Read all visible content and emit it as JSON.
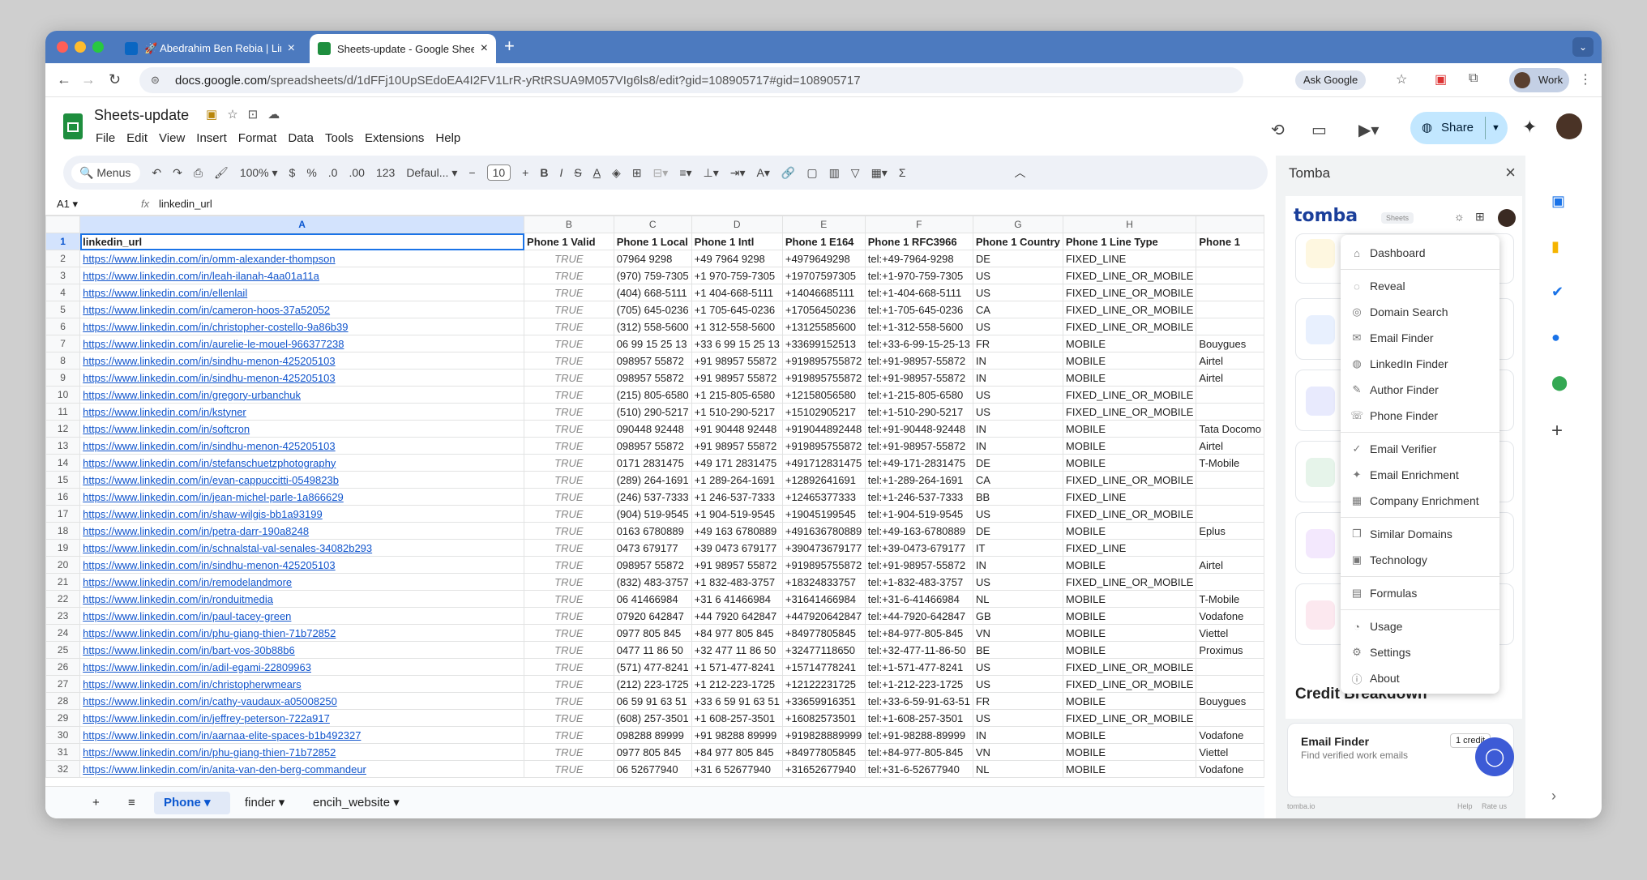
{
  "browser": {
    "tabs": [
      {
        "title": "🚀 Abedrahim Ben Rebia | Lin",
        "close": "×"
      },
      {
        "title": "Sheets-update - Google Shee",
        "close": "×"
      }
    ],
    "new_tab": "+",
    "tab_menu": "⌄",
    "url_host": "docs.google.com",
    "url_path": "/spreadsheets/d/1dFFj10UpSEdoEA4I2FV1LrR-yRtRSUA9M057VIg6ls8/edit?gid=108905717#gid=108905717",
    "ask_google": "Ask Google",
    "profile_label": "Work"
  },
  "sheets": {
    "title": "Sheets-update",
    "menu": [
      "File",
      "Edit",
      "View",
      "Insert",
      "Format",
      "Data",
      "Tools",
      "Extensions",
      "Help"
    ],
    "share_label": "Share",
    "toolbar": {
      "search": "Menus",
      "zoom": "100%",
      "currency": "$",
      "percent": "%",
      "dec_less": ".0",
      "dec_more": ".00",
      "num_format": "123",
      "font": "Defaul...",
      "font_size": "10",
      "minus": "−",
      "plus": "+"
    },
    "name_box": "A1",
    "fx": "fx",
    "formula_value": "linkedin_url",
    "columns": [
      "A",
      "B",
      "C",
      "D",
      "E",
      "F",
      "G",
      "H"
    ],
    "rows": [
      [
        "linkedin_url",
        "Phone 1 Valid",
        "Phone 1 Local",
        "Phone 1 Intl",
        "Phone 1 E164",
        "Phone 1 RFC3966",
        "Phone 1 Country",
        "Phone 1 Line Type",
        "Phone 1"
      ],
      [
        "https://www.linkedin.com/in/omm-alexander-thompson",
        "TRUE",
        "07964 9298",
        "+49 7964 9298",
        "+4979649298",
        "tel:+49-7964-9298",
        "DE",
        "FIXED_LINE",
        ""
      ],
      [
        "https://www.linkedin.com/in/leah-ilanah-4aa01a11a",
        "TRUE",
        "(970) 759-7305",
        "+1 970-759-7305",
        "+19707597305",
        "tel:+1-970-759-7305",
        "US",
        "FIXED_LINE_OR_MOBILE",
        ""
      ],
      [
        "https://www.linkedin.com/in/ellenlail",
        "TRUE",
        "(404) 668-5111",
        "+1 404-668-5111",
        "+14046685111",
        "tel:+1-404-668-5111",
        "US",
        "FIXED_LINE_OR_MOBILE",
        ""
      ],
      [
        "https://www.linkedin.com/in/cameron-hoos-37a52052",
        "TRUE",
        "(705) 645-0236",
        "+1 705-645-0236",
        "+17056450236",
        "tel:+1-705-645-0236",
        "CA",
        "FIXED_LINE_OR_MOBILE",
        ""
      ],
      [
        "https://www.linkedin.com/in/christopher-costello-9a86b39",
        "TRUE",
        "(312) 558-5600",
        "+1 312-558-5600",
        "+13125585600",
        "tel:+1-312-558-5600",
        "US",
        "FIXED_LINE_OR_MOBILE",
        ""
      ],
      [
        "https://www.linkedin.com/in/aurelie-le-mouel-966377238",
        "TRUE",
        "06 99 15 25 13",
        "+33 6 99 15 25 13",
        "+33699152513",
        "tel:+33-6-99-15-25-13",
        "FR",
        "MOBILE",
        "Bouygues"
      ],
      [
        "https://www.linkedin.com/in/sindhu-menon-425205103",
        "TRUE",
        "098957 55872",
        "+91 98957 55872",
        "+919895755872",
        "tel:+91-98957-55872",
        "IN",
        "MOBILE",
        "Airtel"
      ],
      [
        "https://www.linkedin.com/in/sindhu-menon-425205103",
        "TRUE",
        "098957 55872",
        "+91 98957 55872",
        "+919895755872",
        "tel:+91-98957-55872",
        "IN",
        "MOBILE",
        "Airtel"
      ],
      [
        "https://www.linkedin.com/in/gregory-urbanchuk",
        "TRUE",
        "(215) 805-6580",
        "+1 215-805-6580",
        "+12158056580",
        "tel:+1-215-805-6580",
        "US",
        "FIXED_LINE_OR_MOBILE",
        ""
      ],
      [
        "https://www.linkedin.com/in/kstyner",
        "TRUE",
        "(510) 290-5217",
        "+1 510-290-5217",
        "+15102905217",
        "tel:+1-510-290-5217",
        "US",
        "FIXED_LINE_OR_MOBILE",
        ""
      ],
      [
        "https://www.linkedin.com/in/softcron",
        "TRUE",
        "090448 92448",
        "+91 90448 92448",
        "+919044892448",
        "tel:+91-90448-92448",
        "IN",
        "MOBILE",
        "Tata Docomo"
      ],
      [
        "https://www.linkedin.com/in/sindhu-menon-425205103",
        "TRUE",
        "098957 55872",
        "+91 98957 55872",
        "+919895755872",
        "tel:+91-98957-55872",
        "IN",
        "MOBILE",
        "Airtel"
      ],
      [
        "https://www.linkedin.com/in/stefanschuetzphotography",
        "TRUE",
        "0171 2831475",
        "+49 171 2831475",
        "+491712831475",
        "tel:+49-171-2831475",
        "DE",
        "MOBILE",
        "T-Mobile"
      ],
      [
        "https://www.linkedin.com/in/evan-cappuccitti-0549823b",
        "TRUE",
        "(289) 264-1691",
        "+1 289-264-1691",
        "+12892641691",
        "tel:+1-289-264-1691",
        "CA",
        "FIXED_LINE_OR_MOBILE",
        ""
      ],
      [
        "https://www.linkedin.com/in/jean-michel-parle-1a866629",
        "TRUE",
        "(246) 537-7333",
        "+1 246-537-7333",
        "+12465377333",
        "tel:+1-246-537-7333",
        "BB",
        "FIXED_LINE",
        ""
      ],
      [
        "https://www.linkedin.com/in/shaw-wilgis-bb1a93199",
        "TRUE",
        "(904) 519-9545",
        "+1 904-519-9545",
        "+19045199545",
        "tel:+1-904-519-9545",
        "US",
        "FIXED_LINE_OR_MOBILE",
        ""
      ],
      [
        "https://www.linkedin.com/in/petra-darr-190a8248",
        "TRUE",
        "0163 6780889",
        "+49 163 6780889",
        "+491636780889",
        "tel:+49-163-6780889",
        "DE",
        "MOBILE",
        "Eplus"
      ],
      [
        "https://www.linkedin.com/in/schnalstal-val-senales-34082b293",
        "TRUE",
        "0473 679177",
        "+39 0473 679177",
        "+390473679177",
        "tel:+39-0473-679177",
        "IT",
        "FIXED_LINE",
        ""
      ],
      [
        "https://www.linkedin.com/in/sindhu-menon-425205103",
        "TRUE",
        "098957 55872",
        "+91 98957 55872",
        "+919895755872",
        "tel:+91-98957-55872",
        "IN",
        "MOBILE",
        "Airtel"
      ],
      [
        "https://www.linkedin.com/in/remodelandmore",
        "TRUE",
        "(832) 483-3757",
        "+1 832-483-3757",
        "+18324833757",
        "tel:+1-832-483-3757",
        "US",
        "FIXED_LINE_OR_MOBILE",
        ""
      ],
      [
        "https://www.linkedin.com/in/ronduitmedia",
        "TRUE",
        "06 41466984",
        "+31 6 41466984",
        "+31641466984",
        "tel:+31-6-41466984",
        "NL",
        "MOBILE",
        "T-Mobile"
      ],
      [
        "https://www.linkedin.com/in/paul-tacey-green",
        "TRUE",
        "07920 642847",
        "+44 7920 642847",
        "+447920642847",
        "tel:+44-7920-642847",
        "GB",
        "MOBILE",
        "Vodafone"
      ],
      [
        "https://www.linkedin.com/in/phu-giang-thien-71b72852",
        "TRUE",
        "0977 805 845",
        "+84 977 805 845",
        "+84977805845",
        "tel:+84-977-805-845",
        "VN",
        "MOBILE",
        "Viettel"
      ],
      [
        "https://www.linkedin.com/in/bart-vos-30b88b6",
        "TRUE",
        "0477 11 86 50",
        "+32 477 11 86 50",
        "+32477118650",
        "tel:+32-477-11-86-50",
        "BE",
        "MOBILE",
        "Proximus"
      ],
      [
        "https://www.linkedin.com/in/adil-egami-22809963",
        "TRUE",
        "(571) 477-8241",
        "+1 571-477-8241",
        "+15714778241",
        "tel:+1-571-477-8241",
        "US",
        "FIXED_LINE_OR_MOBILE",
        ""
      ],
      [
        "https://www.linkedin.com/in/christopherwmears",
        "TRUE",
        "(212) 223-1725",
        "+1 212-223-1725",
        "+12122231725",
        "tel:+1-212-223-1725",
        "US",
        "FIXED_LINE_OR_MOBILE",
        ""
      ],
      [
        "https://www.linkedin.com/in/cathy-vaudaux-a05008250",
        "TRUE",
        "06 59 91 63 51",
        "+33 6 59 91 63 51",
        "+33659916351",
        "tel:+33-6-59-91-63-51",
        "FR",
        "MOBILE",
        "Bouygues"
      ],
      [
        "https://www.linkedin.com/in/jeffrey-peterson-722a917",
        "TRUE",
        "(608) 257-3501",
        "+1 608-257-3501",
        "+16082573501",
        "tel:+1-608-257-3501",
        "US",
        "FIXED_LINE_OR_MOBILE",
        ""
      ],
      [
        "https://www.linkedin.com/in/aarnaa-elite-spaces-b1b492327",
        "TRUE",
        "098288 89999",
        "+91 98288 89999",
        "+919828889999",
        "tel:+91-98288-89999",
        "IN",
        "MOBILE",
        "Vodafone"
      ],
      [
        "https://www.linkedin.com/in/phu-giang-thien-71b72852",
        "TRUE",
        "0977 805 845",
        "+84 977 805 845",
        "+84977805845",
        "tel:+84-977-805-845",
        "VN",
        "MOBILE",
        "Viettel"
      ],
      [
        "https://www.linkedin.com/in/anita-van-den-berg-commandeur",
        "TRUE",
        "06 52677940",
        "+31 6 52677940",
        "+31652677940",
        "tel:+31-6-52677940",
        "NL",
        "MOBILE",
        "Vodafone"
      ]
    ],
    "sheet_tabs": [
      "Phone",
      "finder",
      "encih_website"
    ],
    "add_sheet": "+",
    "all_sheets": "≡"
  },
  "tomba": {
    "panel_title": "Tomba",
    "close": "×",
    "logo": "tomba",
    "badge": "Sheets",
    "menu": [
      [
        {
          "label": "Dashboard",
          "icon": "⌂"
        }
      ],
      [
        {
          "label": "Reveal",
          "icon": "◌"
        },
        {
          "label": "Domain Search",
          "icon": "◎"
        },
        {
          "label": "Email Finder",
          "icon": "✉"
        },
        {
          "label": "LinkedIn Finder",
          "icon": "◍"
        },
        {
          "label": "Author Finder",
          "icon": "✎"
        },
        {
          "label": "Phone Finder",
          "icon": "☏"
        }
      ],
      [
        {
          "label": "Email Verifier",
          "icon": "✓"
        },
        {
          "label": "Email Enrichment",
          "icon": "✦"
        },
        {
          "label": "Company Enrichment",
          "icon": "▦"
        }
      ],
      [
        {
          "label": "Similar Domains",
          "icon": "❐"
        },
        {
          "label": "Technology",
          "icon": "▣"
        }
      ],
      [
        {
          "label": "Formulas",
          "icon": "▤"
        }
      ],
      [
        {
          "label": "Usage",
          "icon": "◔"
        },
        {
          "label": "Settings",
          "icon": "⚙"
        },
        {
          "label": "About",
          "icon": "ⓘ"
        }
      ]
    ],
    "credit_heading": "Credit Breakdown",
    "card": {
      "title": "Email Finder",
      "subtitle": "Find verified work emails",
      "badge": "1 credit"
    },
    "footer": {
      "left": "tomba.io",
      "help": "Help",
      "rate": "Rate us"
    }
  },
  "colors": {
    "accent": "#0b57d0",
    "link": "#1155cc",
    "tab_bar": "#4c7abf",
    "tomba_logo": "#1a3e9a"
  }
}
